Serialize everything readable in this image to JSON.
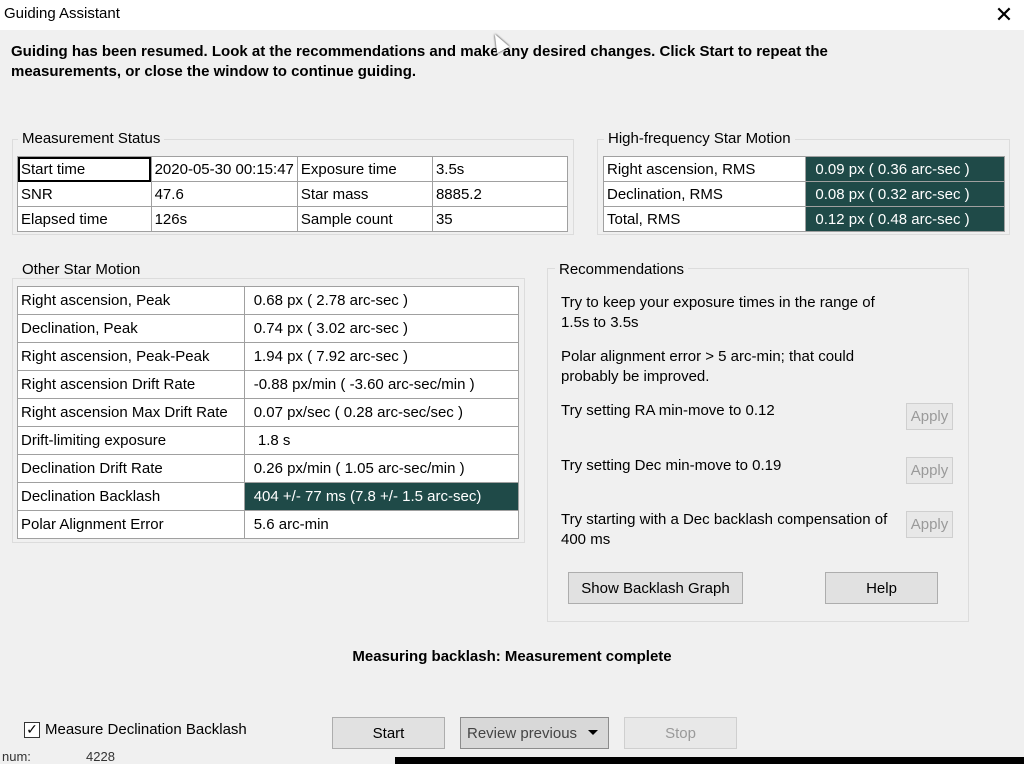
{
  "window": {
    "title": "Guiding Assistant"
  },
  "intro": "Guiding has been resumed. Look at the recommendations and make any desired changes.  Click Start to repeat the measurements, or close the window to continue guiding.",
  "measurement_status": {
    "label": "Measurement Status",
    "rows": [
      [
        "Start time",
        "2020-05-30 00:15:47",
        "Exposure time",
        "3.5s"
      ],
      [
        "SNR",
        "47.6",
        "Star mass",
        "8885.2"
      ],
      [
        "Elapsed time",
        "126s",
        "Sample count",
        "35"
      ]
    ]
  },
  "hf_motion": {
    "label": "High-frequency Star Motion",
    "rows": [
      [
        "Right ascension, RMS",
        "0.09 px (  0.36 arc-sec )"
      ],
      [
        "Declination, RMS",
        "0.08 px (  0.32 arc-sec )"
      ],
      [
        "Total, RMS",
        "0.12 px (  0.48 arc-sec )"
      ]
    ]
  },
  "other_motion": {
    "label": "Other Star Motion",
    "rows": [
      [
        "Right ascension, Peak",
        "0.68 px (  2.78 arc-sec )"
      ],
      [
        "Declination, Peak",
        "0.74 px (  3.02 arc-sec )"
      ],
      [
        "Right ascension, Peak-Peak",
        "1.94 px (  7.92 arc-sec )"
      ],
      [
        "Right ascension Drift Rate",
        "-0.88 px/min ( -3.60 arc-sec/min )"
      ],
      [
        "Right ascension Max Drift Rate",
        "0.07 px/sec (  0.28 arc-sec/sec )"
      ],
      [
        "Drift-limiting exposure",
        " 1.8 s"
      ],
      [
        "Declination Drift Rate",
        "0.26 px/min (  1.05 arc-sec/min )"
      ],
      [
        "Declination Backlash",
        "404  +/-  77 ms (7.8  +/-  1.5 arc-sec)"
      ],
      [
        "Polar Alignment Error",
        "5.6 arc-min"
      ]
    ]
  },
  "recommendations": {
    "label": "Recommendations",
    "exposure": "Try to keep your exposure times in the range of 1.5s to 3.5s",
    "polar": "Polar alignment error > 5 arc-min; that could probably be improved.",
    "ra_minmove": "Try setting RA min-move to 0.12",
    "dec_minmove": "Try setting Dec min-move to 0.19",
    "dec_backlash": "Try starting with a Dec backlash compensation of 400 ms",
    "apply_label": "Apply",
    "show_backlash_label": "Show Backlash Graph",
    "help_label": "Help"
  },
  "status_text": "Measuring backlash: Measurement complete",
  "footer": {
    "measure_backlash_label": "Measure Declination Backlash",
    "measure_backlash_checked": true,
    "start_label": "Start",
    "review_label": "Review previous",
    "stop_label": "Stop"
  },
  "background": {
    "left_text": "num:",
    "value_text": "4228"
  },
  "colors": {
    "dark_cell": "#1f4a48",
    "window_bg": "#f0f0f0"
  }
}
